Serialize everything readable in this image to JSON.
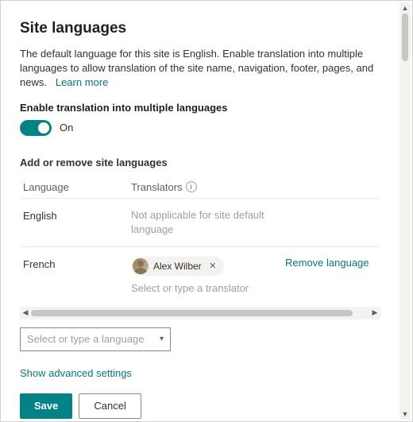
{
  "header": {
    "title": "Site languages",
    "description": "The default language for this site is English. Enable translation into multiple languages to allow translation of the site name, navigation, footer, pages, and news.",
    "learn_more": "Learn more"
  },
  "toggle": {
    "label": "Enable translation into multiple languages",
    "state": "On"
  },
  "section": {
    "title": "Add or remove site languages",
    "col_language": "Language",
    "col_translators": "Translators"
  },
  "rows": [
    {
      "language": "English",
      "na_text": "Not applicable for site default language",
      "is_default": true
    },
    {
      "language": "French",
      "translator_name": "Alex Wilber",
      "placeholder": "Select or type a translator",
      "remove": "Remove language",
      "is_default": false
    }
  ],
  "language_picker": {
    "placeholder": "Select or type a language"
  },
  "advanced_link": "Show advanced settings",
  "buttons": {
    "save": "Save",
    "cancel": "Cancel"
  }
}
